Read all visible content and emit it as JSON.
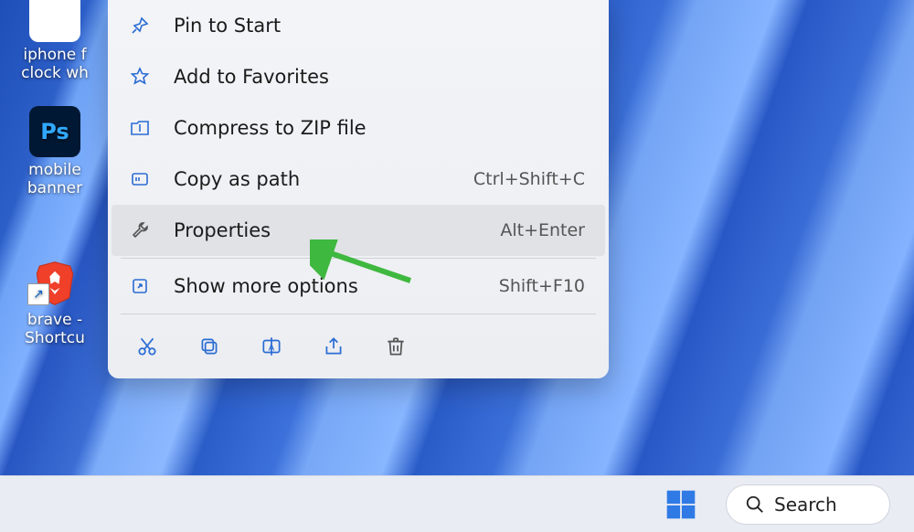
{
  "desktop": {
    "icons": [
      {
        "label": "iphone f\nclock wh",
        "kind": "txt"
      },
      {
        "label": "mobile\nbanner",
        "kind": "ps"
      },
      {
        "label": "brave -\nShortcu",
        "kind": "brave"
      }
    ]
  },
  "context_menu": {
    "items": [
      {
        "icon": "pin-icon",
        "label": "Pin to Start",
        "shortcut": ""
      },
      {
        "icon": "star-icon",
        "label": "Add to Favorites",
        "shortcut": ""
      },
      {
        "icon": "zip-icon",
        "label": "Compress to ZIP file",
        "shortcut": ""
      },
      {
        "icon": "path-icon",
        "label": "Copy as path",
        "shortcut": "Ctrl+Shift+C"
      },
      {
        "icon": "wrench-icon",
        "label": "Properties",
        "shortcut": "Alt+Enter",
        "hover": true
      },
      {
        "sep": true
      },
      {
        "icon": "expand-icon",
        "label": "Show more options",
        "shortcut": "Shift+F10"
      }
    ],
    "footer": [
      "cut-icon",
      "copy-icon",
      "rename-icon",
      "share-icon",
      "delete-icon"
    ]
  },
  "taskbar": {
    "search_label": "Search"
  }
}
